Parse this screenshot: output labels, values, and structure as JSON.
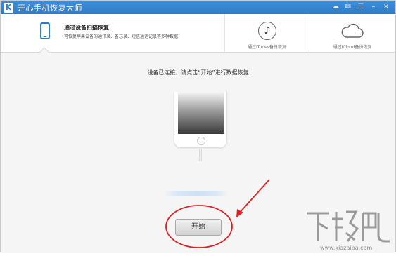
{
  "titlebar": {
    "logo_text": "K",
    "title": "开心手机恢复大师",
    "controls": [
      "☁",
      "✉",
      "☰",
      "–",
      "×"
    ]
  },
  "tabs": {
    "scan": {
      "title": "通过设备扫描恢复",
      "subtitle": "可恢复苹果设备的通讯录、备忘录、短信通话记录等多种数据"
    },
    "itunes": {
      "label": "通过iTunes备份恢复"
    },
    "icloud": {
      "label": "通过iCloud备份恢复"
    }
  },
  "main": {
    "instruction": "设备已连接，请点击“开始”进行数据恢复",
    "start_label": "开始"
  },
  "watermark": {
    "text": "www.xiazaiba.com",
    "logo_text": "下载吧"
  },
  "colors": {
    "titlebar": "#2f7cc9",
    "accent": "#2f7cc9",
    "annotation": "#e02020"
  }
}
